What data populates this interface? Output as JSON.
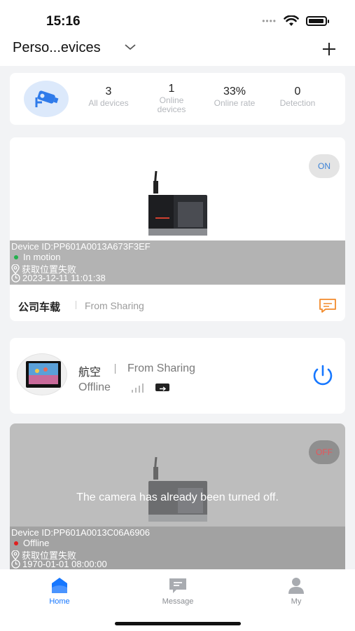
{
  "status_bar": {
    "time": "15:16"
  },
  "header": {
    "title": "Perso...evices"
  },
  "summary": {
    "stats": [
      {
        "value": "3",
        "label": "All devices"
      },
      {
        "value": "1",
        "label": "Online devices"
      },
      {
        "value": "33%",
        "label": "Online rate"
      },
      {
        "value": "0",
        "label": "Detection"
      }
    ]
  },
  "device1": {
    "toggle_label": "ON",
    "device_id": "Device ID:PP601A0013A673F3EF",
    "status": "In motion",
    "location": "获取位置失败",
    "timestamp": "2023-12-11 11:01:38",
    "name": "公司车载",
    "source": "From Sharing",
    "status_color": "#22b14c"
  },
  "device2": {
    "name": "航空",
    "source": "From Sharing",
    "status": "Offline"
  },
  "device3": {
    "toggle_label": "OFF",
    "message": "The camera has already been turned off.",
    "device_id": "Device ID:PP601A0013C06A6906",
    "status": "Offline",
    "location": "获取位置失败",
    "timestamp": "1970-01-01 08:00:00",
    "status_color": "#e02020"
  },
  "tabbar": {
    "tabs": [
      {
        "label": "Home",
        "icon": "home-icon",
        "active": true
      },
      {
        "label": "Message",
        "icon": "message-icon",
        "active": false
      },
      {
        "label": "My",
        "icon": "user-icon",
        "active": false
      }
    ]
  },
  "colors": {
    "accent": "#1677ff",
    "message_icon": "#f28b2c",
    "off_text": "#e8545a"
  }
}
